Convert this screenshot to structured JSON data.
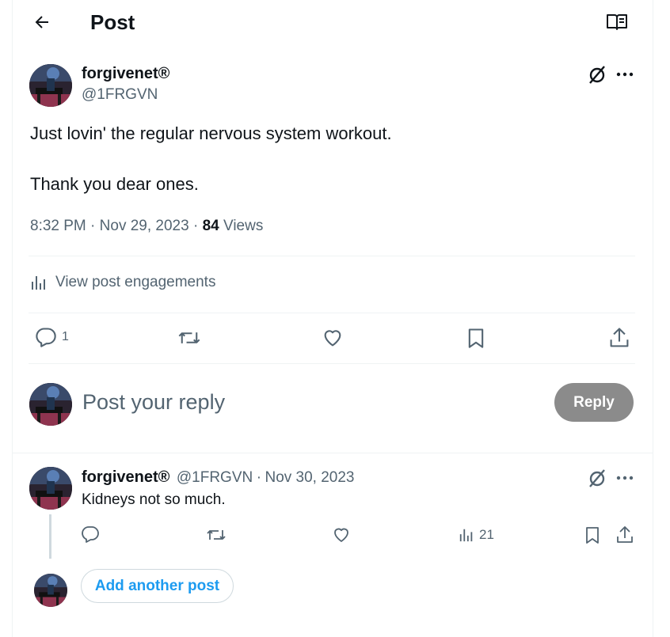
{
  "header": {
    "title": "Post",
    "back_icon": "back-arrow-icon",
    "reader_icon": "open-book-icon"
  },
  "post": {
    "author_name": "forgivenet®",
    "author_handle": "@1FRGVN",
    "text_line1": "Just lovin' the regular nervous system workout.",
    "text_line2": "Thank you dear ones.",
    "time": "8:32 PM",
    "date": "Nov 29, 2023",
    "views_count": "84",
    "views_label": "Views",
    "engagements_label": "View post engagements",
    "reply_count": "1"
  },
  "composer": {
    "placeholder": "Post your reply",
    "reply_label": "Reply"
  },
  "reply": {
    "author_name": "forgivenet®",
    "author_handle": "@1FRGVN",
    "date": "Nov 30, 2023",
    "text": "Kidneys not so much.",
    "views_count": "21"
  },
  "add_post_label": "Add another post",
  "colors": {
    "accent": "#1d9bf0",
    "muted": "#536471",
    "reply_button_bg": "#8b8b8b"
  }
}
